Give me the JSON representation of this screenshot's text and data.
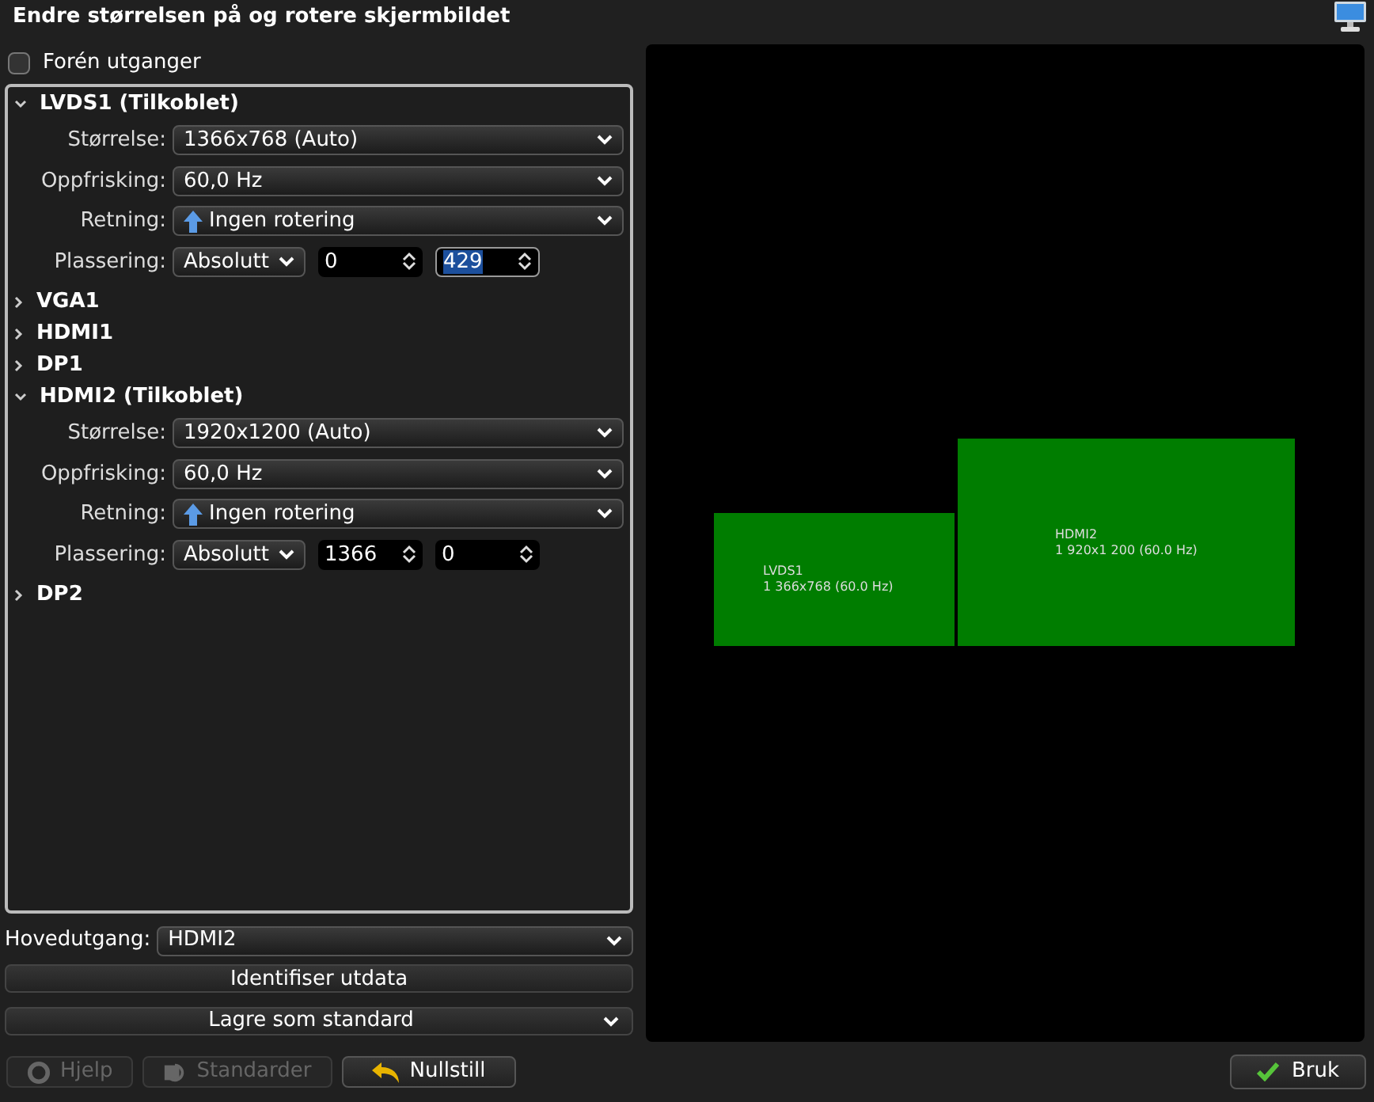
{
  "window": {
    "title": "Endre størrelsen på og rotere skjermbildet"
  },
  "unify": {
    "label": "Forén utganger",
    "checked": false
  },
  "outputs": [
    {
      "name": "LVDS1 (Tilkoblet)",
      "expanded": true,
      "rows": [
        {
          "kind": "select",
          "label": "Størrelse:",
          "value": "1366x768 (Auto)"
        },
        {
          "kind": "select",
          "label": "Oppfrisking:",
          "value": "60,0 Hz"
        },
        {
          "kind": "rotation",
          "label": "Retning:",
          "value": "Ingen rotering"
        },
        {
          "kind": "placement",
          "label": "Plassering:",
          "value": "Absolutt",
          "spins": [
            {
              "value": "0",
              "selected": false
            },
            {
              "value": "429",
              "selected": true
            }
          ]
        }
      ]
    },
    {
      "name": "VGA1",
      "expanded": false
    },
    {
      "name": "HDMI1",
      "expanded": false
    },
    {
      "name": "DP1",
      "expanded": false
    },
    {
      "name": "HDMI2 (Tilkoblet)",
      "expanded": true,
      "rows": [
        {
          "kind": "select",
          "label": "Størrelse:",
          "value": "1920x1200 (Auto)"
        },
        {
          "kind": "select",
          "label": "Oppfrisking:",
          "value": "60,0 Hz"
        },
        {
          "kind": "rotation",
          "label": "Retning:",
          "value": "Ingen rotering"
        },
        {
          "kind": "placement",
          "label": "Plassering:",
          "value": "Absolutt",
          "spins": [
            {
              "value": "1366",
              "selected": false
            },
            {
              "value": "0",
              "selected": false
            }
          ]
        }
      ]
    },
    {
      "name": "DP2",
      "expanded": false
    }
  ],
  "primary": {
    "label": "Hovedutgang:",
    "value": "HDMI2"
  },
  "identify": "Identifiser utdata",
  "save": "Lagre som standard",
  "screens": [
    {
      "name": "LVDS1",
      "info": "1 366x768 (60.0 Hz)"
    },
    {
      "name": "HDMI2",
      "info": "1 920x1 200 (60.0 Hz)"
    }
  ],
  "buttons": [
    {
      "kind": "help",
      "label": "Hjelp",
      "disabled": true
    },
    {
      "kind": "defaults",
      "label": "Standarder",
      "disabled": true
    },
    {
      "kind": "reset",
      "label": "Nullstill",
      "disabled": false
    }
  ],
  "apply": "Bruk"
}
